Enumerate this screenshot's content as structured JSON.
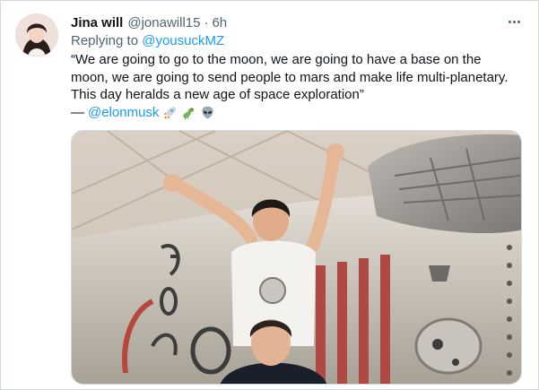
{
  "tweet": {
    "author_name": "Jina will",
    "author_handle": "@jonawill15",
    "separator": "·",
    "time": "6h",
    "replying_prefix": "Replying to",
    "replying_to": "@yousuckMZ",
    "line1": "“We are going to go to the moon, we are going to have a base on the",
    "line2": "moon, we are going to send people to mars and make life multi-planetary.",
    "line3": "This day heralds a new age of space exploration”",
    "signature_dash": "—",
    "signature_mention": "@elonmusk",
    "emojis": [
      "rocket-emoji",
      "dragon-emoji",
      "alien-emoji"
    ]
  },
  "icons": {
    "more": "more-options-icon"
  },
  "colors": {
    "link": "#1d9bf0",
    "text": "#0f1419",
    "secondary": "#536471",
    "border": "#cfd9de"
  }
}
